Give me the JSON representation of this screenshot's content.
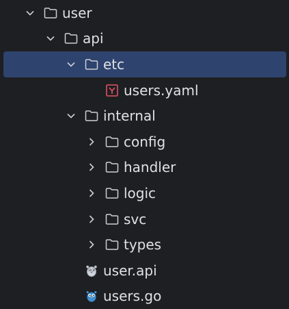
{
  "tree": {
    "rows": [
      {
        "label": "user",
        "type": "folder",
        "expanded": true,
        "depth": 0
      },
      {
        "label": "api",
        "type": "folder",
        "expanded": true,
        "depth": 1
      },
      {
        "label": "etc",
        "type": "folder",
        "expanded": true,
        "depth": 2,
        "selected": true
      },
      {
        "label": "users.yaml",
        "type": "yaml-file",
        "depth": 3
      },
      {
        "label": "internal",
        "type": "folder",
        "expanded": true,
        "depth": 2
      },
      {
        "label": "config",
        "type": "folder",
        "expanded": false,
        "depth": 3
      },
      {
        "label": "handler",
        "type": "folder",
        "expanded": false,
        "depth": 3
      },
      {
        "label": "logic",
        "type": "folder",
        "expanded": false,
        "depth": 3
      },
      {
        "label": "svc",
        "type": "folder",
        "expanded": false,
        "depth": 3
      },
      {
        "label": "types",
        "type": "folder",
        "expanded": false,
        "depth": 3
      },
      {
        "label": "user.api",
        "type": "api-file",
        "depth": 2
      },
      {
        "label": "users.go",
        "type": "go-file",
        "depth": 2
      }
    ]
  },
  "colors": {
    "background": "#1e1f22",
    "selection": "#2e436e",
    "text": "#dfe1e5",
    "icon_stroke": "#ced0d6",
    "yaml_icon": "#e55765",
    "go_icon": "#3d8fd1"
  },
  "icons": {
    "folder": "folder-icon",
    "expanded": "chevron-down-icon",
    "collapsed": "chevron-right-icon",
    "yaml": "yaml-file-icon",
    "api": "go-gopher-outline-icon",
    "go": "go-gopher-icon"
  }
}
